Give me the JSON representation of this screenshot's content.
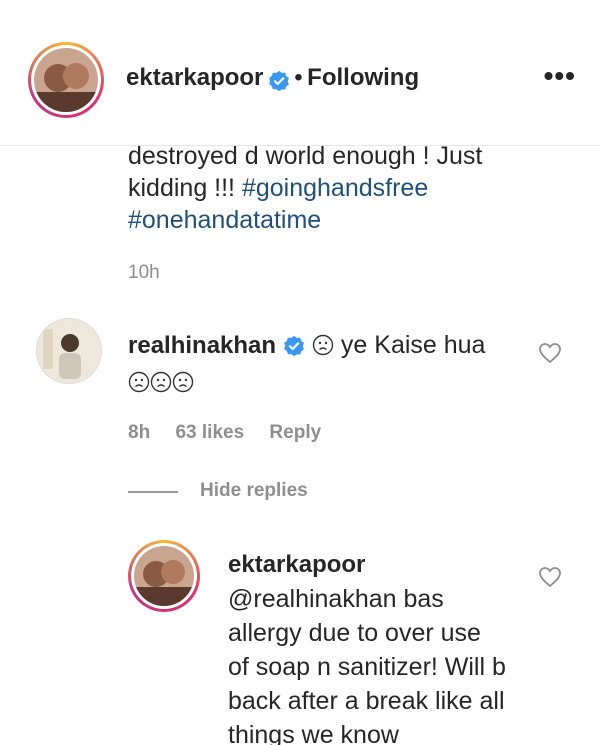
{
  "post_header": {
    "username": "ektarkapoor",
    "separator": "•",
    "follow_status": "Following",
    "more_label": "•••"
  },
  "caption": {
    "line1": "destroyed d world enough ! Just",
    "line2_prefix": "kidding !!! ",
    "hashtag1": "#goinghandsfree",
    "hashtag2": "#onehandatatime",
    "time": "10h"
  },
  "comment": {
    "username": "realhinakhan",
    "text": "ye Kaise hua",
    "time": "8h",
    "likes": "63 likes",
    "reply_label": "Reply"
  },
  "replies_toggle": {
    "label": "Hide replies"
  },
  "reply": {
    "username": "ektarkapoor",
    "lines": [
      "@realhinakhan bas",
      "allergy due to over use",
      "of soap n sanitizer! Will b",
      "back after a break like all",
      "things we know"
    ]
  },
  "colors": {
    "text": "#262626",
    "muted": "#8e8e8e",
    "hashtag": "#1e4f7d",
    "verified": "#3897f0"
  },
  "icons": [
    "verified-badge-icon",
    "more-options-icon",
    "heart-icon",
    "worried-face-emoji"
  ]
}
